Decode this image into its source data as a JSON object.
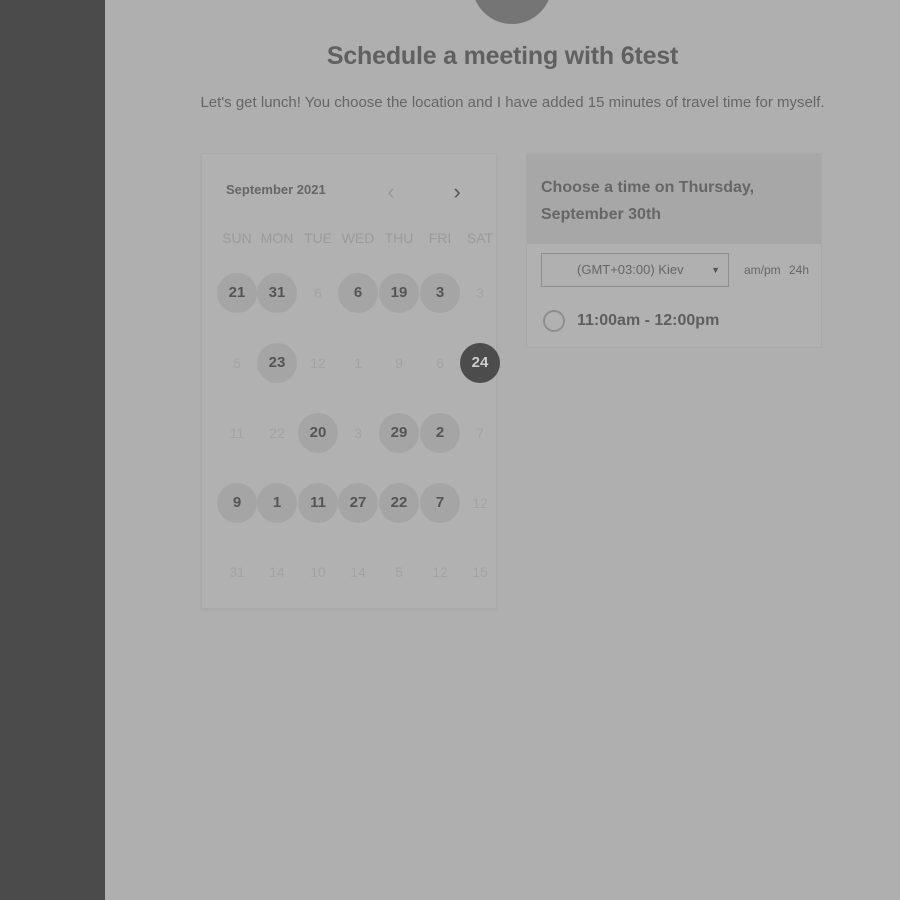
{
  "header": {
    "title": "Schedule a meeting with 6test",
    "subtitle": "Let's get lunch! You choose the location and I have added 15 minutes of travel time for myself."
  },
  "calendar": {
    "month_label": "September 2021",
    "prev_icon": "chevron-left-icon",
    "next_icon": "chevron-right-icon",
    "weekdays": [
      "SUN",
      "MON",
      "TUE",
      "WED",
      "THU",
      "FRI",
      "SAT"
    ],
    "weeks": [
      [
        {
          "label": "21",
          "state": "available"
        },
        {
          "label": "31",
          "state": "available"
        },
        {
          "label": "6",
          "state": "muted"
        },
        {
          "label": "6",
          "state": "available"
        },
        {
          "label": "19",
          "state": "available"
        },
        {
          "label": "3",
          "state": "available"
        },
        {
          "label": "3",
          "state": "muted"
        }
      ],
      [
        {
          "label": "5",
          "state": "muted"
        },
        {
          "label": "23",
          "state": "available"
        },
        {
          "label": "12",
          "state": "muted"
        },
        {
          "label": "1",
          "state": "muted"
        },
        {
          "label": "9",
          "state": "muted"
        },
        {
          "label": "6",
          "state": "muted"
        },
        {
          "label": "24",
          "state": "selected"
        }
      ],
      [
        {
          "label": "11",
          "state": "muted"
        },
        {
          "label": "22",
          "state": "muted"
        },
        {
          "label": "20",
          "state": "available"
        },
        {
          "label": "3",
          "state": "muted"
        },
        {
          "label": "29",
          "state": "available"
        },
        {
          "label": "2",
          "state": "available"
        },
        {
          "label": "7",
          "state": "muted"
        }
      ],
      [
        {
          "label": "9",
          "state": "available"
        },
        {
          "label": "1",
          "state": "available"
        },
        {
          "label": "11",
          "state": "available"
        },
        {
          "label": "27",
          "state": "available"
        },
        {
          "label": "22",
          "state": "available"
        },
        {
          "label": "7",
          "state": "available"
        },
        {
          "label": "12",
          "state": "muted"
        }
      ],
      [
        {
          "label": "31",
          "state": "muted"
        },
        {
          "label": "14",
          "state": "muted"
        },
        {
          "label": "10",
          "state": "muted"
        },
        {
          "label": "14",
          "state": "muted"
        },
        {
          "label": "5",
          "state": "muted"
        },
        {
          "label": "12",
          "state": "muted"
        },
        {
          "label": "15",
          "state": "muted"
        }
      ]
    ]
  },
  "times": {
    "heading": "Choose a time on Thursday, September 30th",
    "timezone": "(GMT+03:00) Kiev",
    "format_ampm": "am/pm",
    "format_24": "24h",
    "slots": [
      {
        "label": "11:00am - 12:00pm",
        "selected": false
      }
    ]
  }
}
